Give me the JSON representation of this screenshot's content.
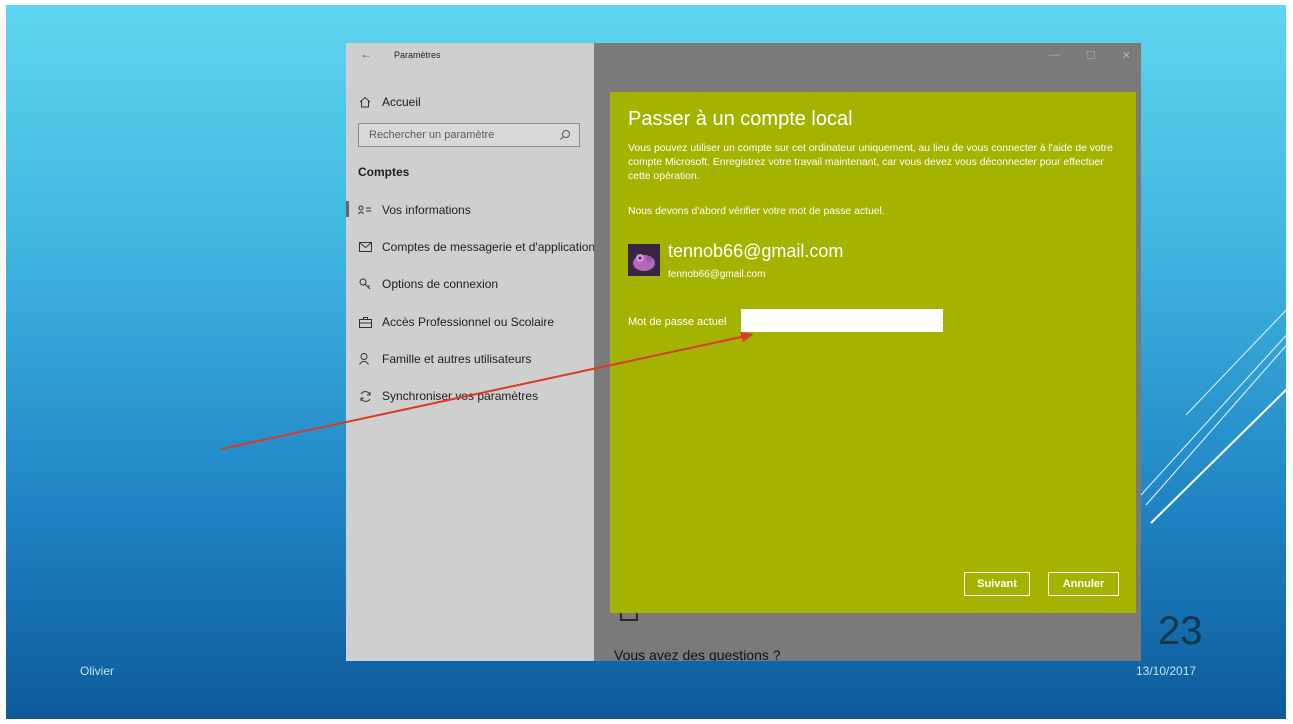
{
  "slide": {
    "footer_left": "Olivier",
    "date": "13/10/2017",
    "page_number": "23"
  },
  "window": {
    "title": "Paramètres",
    "controls": [
      "—",
      "☐",
      "✕"
    ]
  },
  "sidebar": {
    "home_label": "Accueil",
    "search_placeholder": "Rechercher un paramètre",
    "section_title": "Comptes",
    "items": [
      {
        "label": "Vos informations",
        "icon": "person-card-icon"
      },
      {
        "label": "Comptes de messagerie et d'application",
        "icon": "mail-icon"
      },
      {
        "label": "Options de connexion",
        "icon": "key-icon"
      },
      {
        "label": "Accès Professionnel ou Scolaire",
        "icon": "briefcase-icon"
      },
      {
        "label": "Famille et autres utilisateurs",
        "icon": "person-add-icon"
      },
      {
        "label": "Synchroniser vos paramètres",
        "icon": "sync-icon"
      }
    ]
  },
  "content": {
    "questions": "Vous avez des questions ?"
  },
  "dialog": {
    "title": "Passer à un compte local",
    "paragraph": "Vous pouvez utiliser un compte sur cet ordinateur uniquement, au lieu de vous connecter à l'aide de votre compte Microsoft. Enregistrez votre travail maintenant, car vous devez vous déconnecter pour effectuer cette opération.",
    "verify_text": "Nous devons d'abord vérifier votre mot de passe actuel.",
    "account_name": "tennob66@gmail.com",
    "account_email": "tennob66@gmail.com",
    "password_label": "Mot de passe actuel",
    "password_value": "",
    "next_label": "Suivant",
    "cancel_label": "Annuler"
  },
  "colors": {
    "dialog_bg": "#a4b300",
    "arrow": "#d93a2b"
  }
}
